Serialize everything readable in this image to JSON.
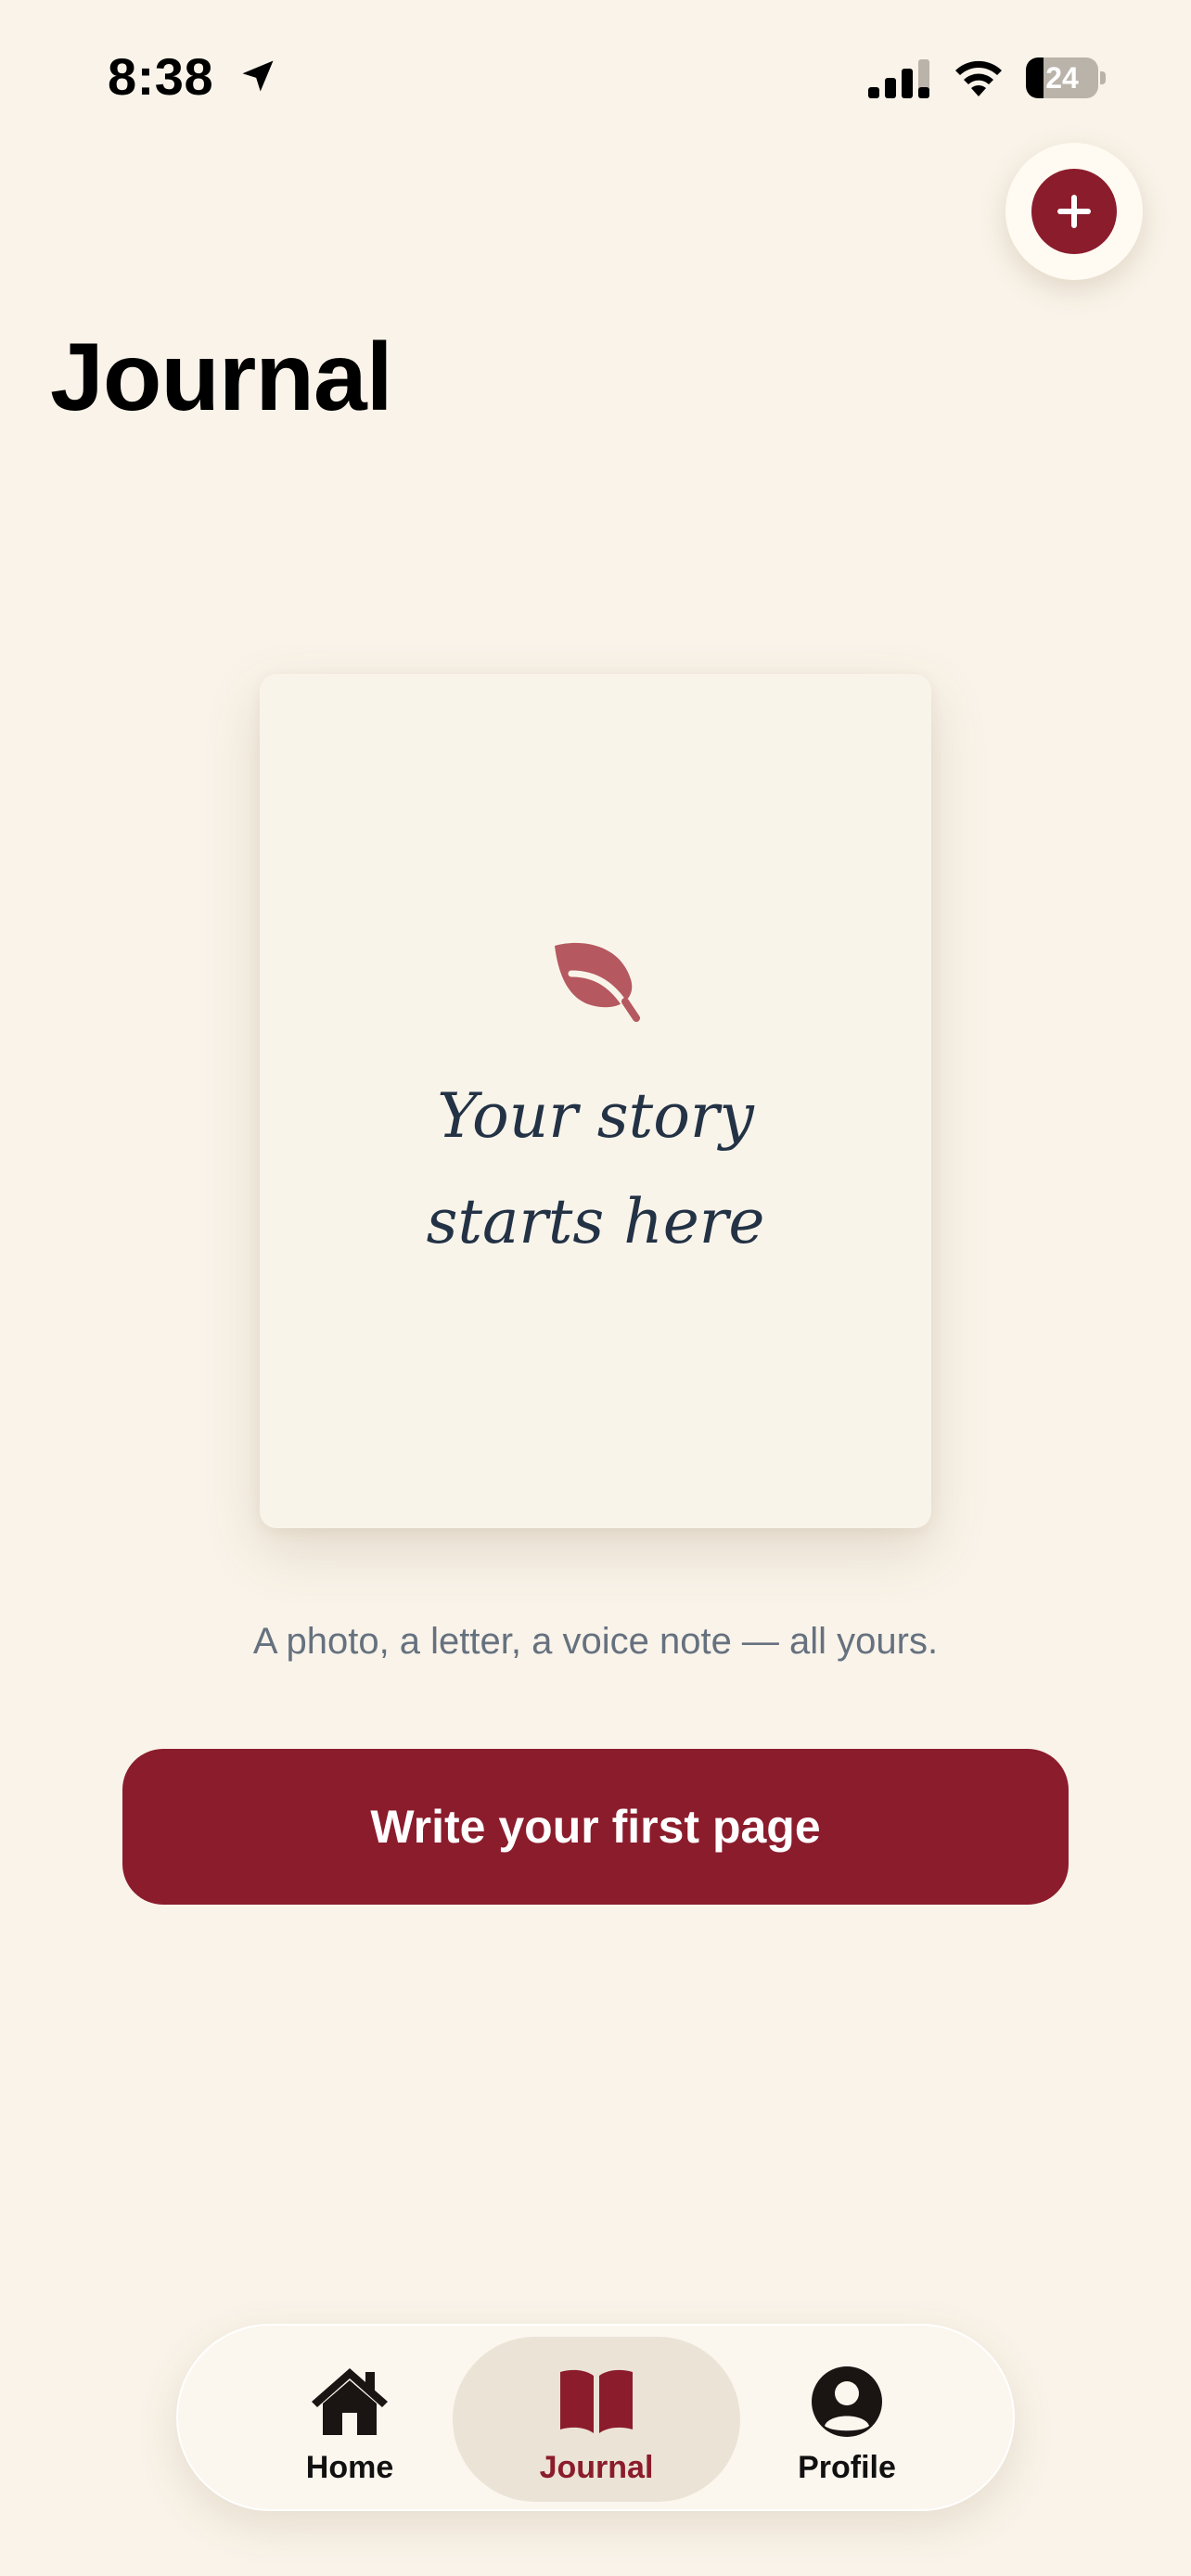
{
  "status_bar": {
    "time": "8:38",
    "battery_percent": "24",
    "battery_level": 0.24,
    "icons": [
      "location-arrow-icon",
      "cellular-signal-icon",
      "wifi-icon",
      "battery-icon"
    ]
  },
  "header": {
    "title": "Journal",
    "add_button_icon": "plus-icon"
  },
  "empty_state": {
    "icon": "leaf-icon",
    "headline_line1": "Your story",
    "headline_line2": "starts here",
    "subtitle": "A photo, a letter, a voice note — all yours.",
    "cta_label": "Write your first page"
  },
  "tab_bar": {
    "items": [
      {
        "label": "Home",
        "icon": "house-icon",
        "active": false
      },
      {
        "label": "Journal",
        "icon": "open-book-icon",
        "active": true
      },
      {
        "label": "Profile",
        "icon": "person-circle-icon",
        "active": false
      }
    ]
  },
  "colors": {
    "background": "#f9f3e9",
    "accent": "#8b1c2c",
    "leaf": "#b5585f",
    "headline_ink": "#233245",
    "subtitle_text": "#66717f",
    "active_tab_bg": "#ebe3d6"
  }
}
